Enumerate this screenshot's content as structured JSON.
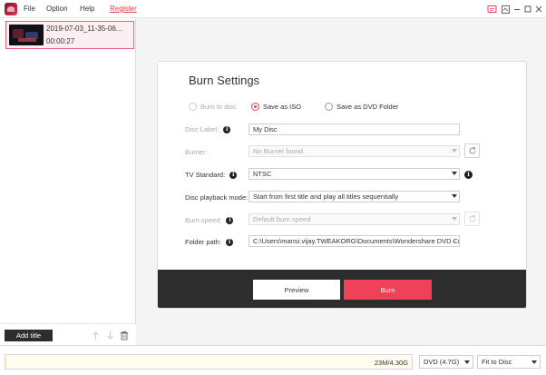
{
  "titlebar": {
    "menu": [
      "File",
      "Option",
      "Help"
    ],
    "register": "Register",
    "icons": [
      "app-logo",
      "notification-icon",
      "feedback-icon",
      "minimize-icon",
      "maximize-icon",
      "close-icon"
    ]
  },
  "sidebar": {
    "item": {
      "name": "2019-07-03_11-35-06...",
      "duration": "00:00:27"
    },
    "add_title": "Add title",
    "icons": [
      "arrow-up-icon",
      "arrow-down-icon",
      "trash-icon"
    ]
  },
  "burn": {
    "title": "Burn Settings",
    "options": [
      "Burn to disc",
      "Save as ISO",
      "Save as DVD Folder"
    ],
    "selected_option": "Save as ISO",
    "labels": {
      "disc_label": "Disc Label:",
      "burner": "Burner:",
      "tv_standard": "TV Standard:",
      "playback": "Disc playback mode:",
      "burn_speed": "Burn speed:",
      "folder_path": "Folder path:"
    },
    "values": {
      "disc_label": "My Disc",
      "burner": "No Burner found.",
      "tv_standard": "NTSC",
      "playback": "Start from first title and play all titles sequentially",
      "burn_speed": "Default burn speed",
      "folder_path": "C:\\Users\\mansi.vijay.TWEAKORG\\Documents\\Wondershare DVD Cr"
    },
    "folder_browse": "···",
    "info_glyph": "i",
    "preview": "Preview",
    "burn": "Burn"
  },
  "status": {
    "usage": "23M/4.30G",
    "usage_fraction": 0.005,
    "disc_type": "DVD (4.7G)",
    "fit": "Fit to Disc"
  }
}
